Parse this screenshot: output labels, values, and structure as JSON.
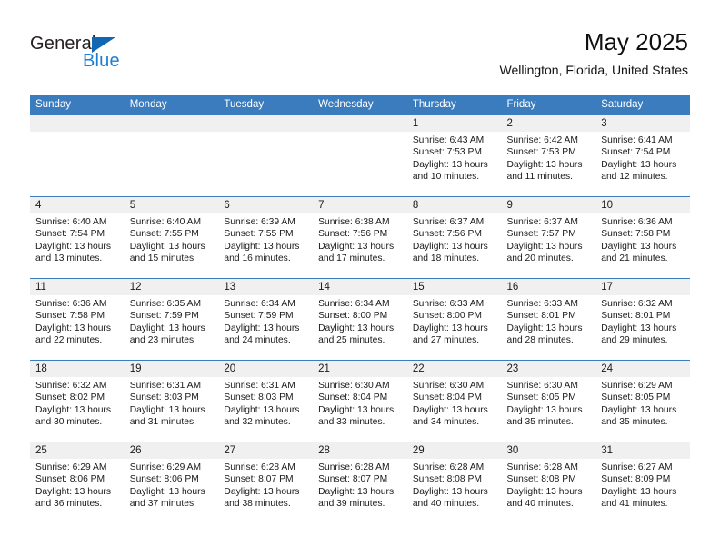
{
  "brand": {
    "name_part1": "General",
    "name_part2": "Blue",
    "triangle_color": "#1267b2",
    "blue_text_color": "#1b7fd4"
  },
  "header": {
    "month_title": "May 2025",
    "location": "Wellington, Florida, United States"
  },
  "colors": {
    "header_blue": "#3a7cbe",
    "day_band_gray": "#f0f0f0",
    "cell_white": "#ffffff",
    "text": "#1a1a1a"
  },
  "weekdays": [
    "Sunday",
    "Monday",
    "Tuesday",
    "Wednesday",
    "Thursday",
    "Friday",
    "Saturday"
  ],
  "weeks": [
    [
      {
        "day": "",
        "sunrise": "",
        "sunset": "",
        "daylight_line1": "",
        "daylight_line2": ""
      },
      {
        "day": "",
        "sunrise": "",
        "sunset": "",
        "daylight_line1": "",
        "daylight_line2": ""
      },
      {
        "day": "",
        "sunrise": "",
        "sunset": "",
        "daylight_line1": "",
        "daylight_line2": ""
      },
      {
        "day": "",
        "sunrise": "",
        "sunset": "",
        "daylight_line1": "",
        "daylight_line2": ""
      },
      {
        "day": "1",
        "sunrise": "Sunrise: 6:43 AM",
        "sunset": "Sunset: 7:53 PM",
        "daylight_line1": "Daylight: 13 hours",
        "daylight_line2": "and 10 minutes."
      },
      {
        "day": "2",
        "sunrise": "Sunrise: 6:42 AM",
        "sunset": "Sunset: 7:53 PM",
        "daylight_line1": "Daylight: 13 hours",
        "daylight_line2": "and 11 minutes."
      },
      {
        "day": "3",
        "sunrise": "Sunrise: 6:41 AM",
        "sunset": "Sunset: 7:54 PM",
        "daylight_line1": "Daylight: 13 hours",
        "daylight_line2": "and 12 minutes."
      }
    ],
    [
      {
        "day": "4",
        "sunrise": "Sunrise: 6:40 AM",
        "sunset": "Sunset: 7:54 PM",
        "daylight_line1": "Daylight: 13 hours",
        "daylight_line2": "and 13 minutes."
      },
      {
        "day": "5",
        "sunrise": "Sunrise: 6:40 AM",
        "sunset": "Sunset: 7:55 PM",
        "daylight_line1": "Daylight: 13 hours",
        "daylight_line2": "and 15 minutes."
      },
      {
        "day": "6",
        "sunrise": "Sunrise: 6:39 AM",
        "sunset": "Sunset: 7:55 PM",
        "daylight_line1": "Daylight: 13 hours",
        "daylight_line2": "and 16 minutes."
      },
      {
        "day": "7",
        "sunrise": "Sunrise: 6:38 AM",
        "sunset": "Sunset: 7:56 PM",
        "daylight_line1": "Daylight: 13 hours",
        "daylight_line2": "and 17 minutes."
      },
      {
        "day": "8",
        "sunrise": "Sunrise: 6:37 AM",
        "sunset": "Sunset: 7:56 PM",
        "daylight_line1": "Daylight: 13 hours",
        "daylight_line2": "and 18 minutes."
      },
      {
        "day": "9",
        "sunrise": "Sunrise: 6:37 AM",
        "sunset": "Sunset: 7:57 PM",
        "daylight_line1": "Daylight: 13 hours",
        "daylight_line2": "and 20 minutes."
      },
      {
        "day": "10",
        "sunrise": "Sunrise: 6:36 AM",
        "sunset": "Sunset: 7:58 PM",
        "daylight_line1": "Daylight: 13 hours",
        "daylight_line2": "and 21 minutes."
      }
    ],
    [
      {
        "day": "11",
        "sunrise": "Sunrise: 6:36 AM",
        "sunset": "Sunset: 7:58 PM",
        "daylight_line1": "Daylight: 13 hours",
        "daylight_line2": "and 22 minutes."
      },
      {
        "day": "12",
        "sunrise": "Sunrise: 6:35 AM",
        "sunset": "Sunset: 7:59 PM",
        "daylight_line1": "Daylight: 13 hours",
        "daylight_line2": "and 23 minutes."
      },
      {
        "day": "13",
        "sunrise": "Sunrise: 6:34 AM",
        "sunset": "Sunset: 7:59 PM",
        "daylight_line1": "Daylight: 13 hours",
        "daylight_line2": "and 24 minutes."
      },
      {
        "day": "14",
        "sunrise": "Sunrise: 6:34 AM",
        "sunset": "Sunset: 8:00 PM",
        "daylight_line1": "Daylight: 13 hours",
        "daylight_line2": "and 25 minutes."
      },
      {
        "day": "15",
        "sunrise": "Sunrise: 6:33 AM",
        "sunset": "Sunset: 8:00 PM",
        "daylight_line1": "Daylight: 13 hours",
        "daylight_line2": "and 27 minutes."
      },
      {
        "day": "16",
        "sunrise": "Sunrise: 6:33 AM",
        "sunset": "Sunset: 8:01 PM",
        "daylight_line1": "Daylight: 13 hours",
        "daylight_line2": "and 28 minutes."
      },
      {
        "day": "17",
        "sunrise": "Sunrise: 6:32 AM",
        "sunset": "Sunset: 8:01 PM",
        "daylight_line1": "Daylight: 13 hours",
        "daylight_line2": "and 29 minutes."
      }
    ],
    [
      {
        "day": "18",
        "sunrise": "Sunrise: 6:32 AM",
        "sunset": "Sunset: 8:02 PM",
        "daylight_line1": "Daylight: 13 hours",
        "daylight_line2": "and 30 minutes."
      },
      {
        "day": "19",
        "sunrise": "Sunrise: 6:31 AM",
        "sunset": "Sunset: 8:03 PM",
        "daylight_line1": "Daylight: 13 hours",
        "daylight_line2": "and 31 minutes."
      },
      {
        "day": "20",
        "sunrise": "Sunrise: 6:31 AM",
        "sunset": "Sunset: 8:03 PM",
        "daylight_line1": "Daylight: 13 hours",
        "daylight_line2": "and 32 minutes."
      },
      {
        "day": "21",
        "sunrise": "Sunrise: 6:30 AM",
        "sunset": "Sunset: 8:04 PM",
        "daylight_line1": "Daylight: 13 hours",
        "daylight_line2": "and 33 minutes."
      },
      {
        "day": "22",
        "sunrise": "Sunrise: 6:30 AM",
        "sunset": "Sunset: 8:04 PM",
        "daylight_line1": "Daylight: 13 hours",
        "daylight_line2": "and 34 minutes."
      },
      {
        "day": "23",
        "sunrise": "Sunrise: 6:30 AM",
        "sunset": "Sunset: 8:05 PM",
        "daylight_line1": "Daylight: 13 hours",
        "daylight_line2": "and 35 minutes."
      },
      {
        "day": "24",
        "sunrise": "Sunrise: 6:29 AM",
        "sunset": "Sunset: 8:05 PM",
        "daylight_line1": "Daylight: 13 hours",
        "daylight_line2": "and 35 minutes."
      }
    ],
    [
      {
        "day": "25",
        "sunrise": "Sunrise: 6:29 AM",
        "sunset": "Sunset: 8:06 PM",
        "daylight_line1": "Daylight: 13 hours",
        "daylight_line2": "and 36 minutes."
      },
      {
        "day": "26",
        "sunrise": "Sunrise: 6:29 AM",
        "sunset": "Sunset: 8:06 PM",
        "daylight_line1": "Daylight: 13 hours",
        "daylight_line2": "and 37 minutes."
      },
      {
        "day": "27",
        "sunrise": "Sunrise: 6:28 AM",
        "sunset": "Sunset: 8:07 PM",
        "daylight_line1": "Daylight: 13 hours",
        "daylight_line2": "and 38 minutes."
      },
      {
        "day": "28",
        "sunrise": "Sunrise: 6:28 AM",
        "sunset": "Sunset: 8:07 PM",
        "daylight_line1": "Daylight: 13 hours",
        "daylight_line2": "and 39 minutes."
      },
      {
        "day": "29",
        "sunrise": "Sunrise: 6:28 AM",
        "sunset": "Sunset: 8:08 PM",
        "daylight_line1": "Daylight: 13 hours",
        "daylight_line2": "and 40 minutes."
      },
      {
        "day": "30",
        "sunrise": "Sunrise: 6:28 AM",
        "sunset": "Sunset: 8:08 PM",
        "daylight_line1": "Daylight: 13 hours",
        "daylight_line2": "and 40 minutes."
      },
      {
        "day": "31",
        "sunrise": "Sunrise: 6:27 AM",
        "sunset": "Sunset: 8:09 PM",
        "daylight_line1": "Daylight: 13 hours",
        "daylight_line2": "and 41 minutes."
      }
    ]
  ]
}
